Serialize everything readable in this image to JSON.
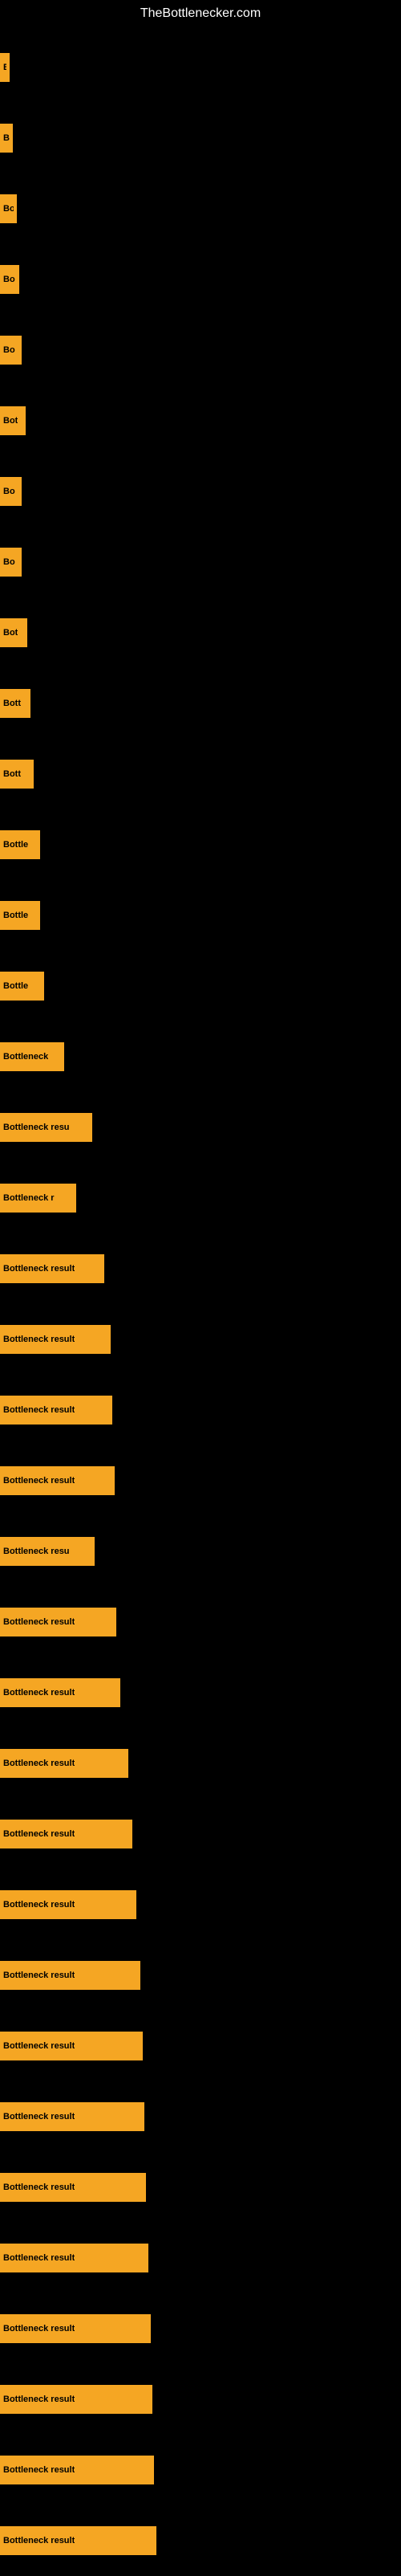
{
  "site": {
    "title": "TheBottlenecker.com"
  },
  "bars": [
    {
      "id": 1,
      "label": "B",
      "width": 12
    },
    {
      "id": 2,
      "label": "B",
      "width": 16
    },
    {
      "id": 3,
      "label": "Bo",
      "width": 21
    },
    {
      "id": 4,
      "label": "Bo",
      "width": 24
    },
    {
      "id": 5,
      "label": "Bo",
      "width": 27
    },
    {
      "id": 6,
      "label": "Bot",
      "width": 32
    },
    {
      "id": 7,
      "label": "Bo",
      "width": 27
    },
    {
      "id": 8,
      "label": "Bo",
      "width": 27
    },
    {
      "id": 9,
      "label": "Bot",
      "width": 34
    },
    {
      "id": 10,
      "label": "Bott",
      "width": 38
    },
    {
      "id": 11,
      "label": "Bott",
      "width": 42
    },
    {
      "id": 12,
      "label": "Bottle",
      "width": 50
    },
    {
      "id": 13,
      "label": "Bottle",
      "width": 50
    },
    {
      "id": 14,
      "label": "Bottle",
      "width": 55
    },
    {
      "id": 15,
      "label": "Bottleneck",
      "width": 80
    },
    {
      "id": 16,
      "label": "Bottleneck resu",
      "width": 115
    },
    {
      "id": 17,
      "label": "Bottleneck r",
      "width": 95
    },
    {
      "id": 18,
      "label": "Bottleneck result",
      "width": 130
    },
    {
      "id": 19,
      "label": "Bottleneck result",
      "width": 138
    },
    {
      "id": 20,
      "label": "Bottleneck result",
      "width": 140
    },
    {
      "id": 21,
      "label": "Bottleneck result",
      "width": 143
    },
    {
      "id": 22,
      "label": "Bottleneck resu",
      "width": 118
    },
    {
      "id": 23,
      "label": "Bottleneck result",
      "width": 145
    },
    {
      "id": 24,
      "label": "Bottleneck result",
      "width": 150
    },
    {
      "id": 25,
      "label": "Bottleneck result",
      "width": 160
    },
    {
      "id": 26,
      "label": "Bottleneck result",
      "width": 165
    },
    {
      "id": 27,
      "label": "Bottleneck result",
      "width": 170
    },
    {
      "id": 28,
      "label": "Bottleneck result",
      "width": 175
    },
    {
      "id": 29,
      "label": "Bottleneck result",
      "width": 178
    },
    {
      "id": 30,
      "label": "Bottleneck result",
      "width": 180
    },
    {
      "id": 31,
      "label": "Bottleneck result",
      "width": 182
    },
    {
      "id": 32,
      "label": "Bottleneck result",
      "width": 185
    },
    {
      "id": 33,
      "label": "Bottleneck result",
      "width": 188
    },
    {
      "id": 34,
      "label": "Bottleneck result",
      "width": 190
    },
    {
      "id": 35,
      "label": "Bottleneck result",
      "width": 192
    },
    {
      "id": 36,
      "label": "Bottleneck result",
      "width": 195
    }
  ]
}
